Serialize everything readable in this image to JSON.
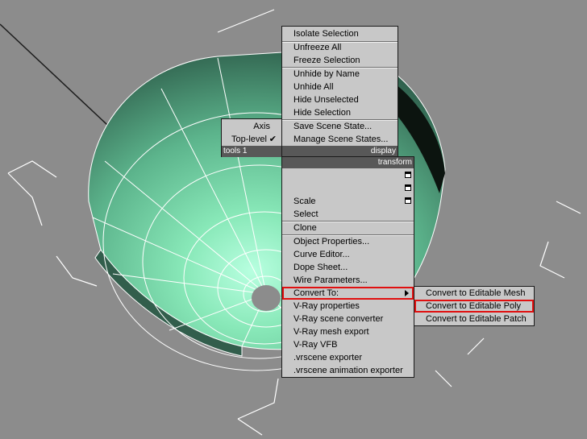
{
  "colors": {
    "viewport_bg": "#8c8c8c",
    "mesh_light": "#a8f0d0",
    "mesh_dark": "#2c5a48",
    "menu_bg": "#c8c8c8",
    "header_bg": "#585858",
    "highlight": "#e01010"
  },
  "quad_left": {
    "items": [
      {
        "label": "Axis"
      },
      {
        "label": "Top-level",
        "checked": "✔"
      }
    ],
    "header": "tools 1"
  },
  "quad_top_right": {
    "items": [
      {
        "label": "Isolate Selection"
      },
      {
        "label": "Unfreeze All"
      },
      {
        "label": "Freeze Selection"
      },
      {
        "label": "Unhide by Name"
      },
      {
        "label": "Unhide All"
      },
      {
        "label": "Hide Unselected"
      },
      {
        "label": "Hide Selection"
      },
      {
        "label": "Save Scene State..."
      },
      {
        "label": "Manage Scene States..."
      }
    ],
    "header": "display"
  },
  "quad_bottom_right": {
    "header": "transform",
    "items": [
      {
        "label": "Scale"
      },
      {
        "label": "Select"
      },
      {
        "label": "Clone"
      },
      {
        "label": "Object Properties..."
      },
      {
        "label": "Curve Editor..."
      },
      {
        "label": "Dope Sheet..."
      },
      {
        "label": "Wire Parameters..."
      },
      {
        "label": "Convert To:"
      },
      {
        "label": "V-Ray properties"
      },
      {
        "label": "V-Ray scene converter"
      },
      {
        "label": "V-Ray mesh export"
      },
      {
        "label": "V-Ray VFB"
      },
      {
        "label": ".vrscene exporter"
      },
      {
        "label": ".vrscene animation exporter"
      }
    ]
  },
  "submenu": {
    "items": [
      {
        "label": "Convert to Editable Mesh"
      },
      {
        "label": "Convert to Editable Poly"
      },
      {
        "label": "Convert to Editable Patch"
      }
    ]
  }
}
